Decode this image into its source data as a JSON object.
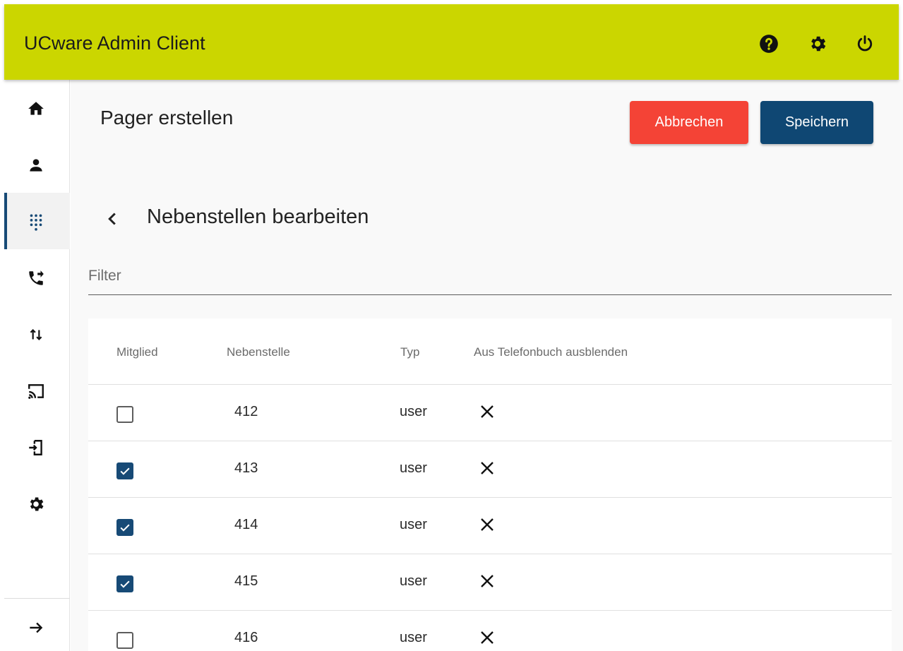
{
  "app": {
    "title": "UCware Admin Client"
  },
  "header_icons": [
    "help-icon",
    "settings-icon",
    "power-icon"
  ],
  "sidebar": {
    "items": [
      {
        "icon": "home-icon",
        "active": false
      },
      {
        "icon": "person-icon",
        "active": false
      },
      {
        "icon": "dialpad-icon",
        "active": true
      },
      {
        "icon": "phone-forward-icon",
        "active": false
      },
      {
        "icon": "swap-vert-icon",
        "active": false
      },
      {
        "icon": "cast-icon",
        "active": false
      },
      {
        "icon": "phone-login-icon",
        "active": false
      },
      {
        "icon": "settings-icon",
        "active": false
      }
    ],
    "footer_icon": "arrow-right-icon"
  },
  "page": {
    "title": "Pager erstellen",
    "cancel_label": "Abbrechen",
    "save_label": "Speichern",
    "section_title": "Nebenstellen bearbeiten"
  },
  "filter": {
    "placeholder": "Filter",
    "value": ""
  },
  "table": {
    "columns": [
      "Mitglied",
      "Nebenstelle",
      "Typ",
      "Aus Telefonbuch ausblenden"
    ],
    "rows": [
      {
        "member": false,
        "extension": "412",
        "type": "user",
        "hidden_icon": "close-icon"
      },
      {
        "member": true,
        "extension": "413",
        "type": "user",
        "hidden_icon": "close-icon"
      },
      {
        "member": true,
        "extension": "414",
        "type": "user",
        "hidden_icon": "close-icon"
      },
      {
        "member": true,
        "extension": "415",
        "type": "user",
        "hidden_icon": "close-icon"
      },
      {
        "member": false,
        "extension": "416",
        "type": "user",
        "hidden_icon": "close-icon"
      }
    ]
  },
  "colors": {
    "header": "#cbd600",
    "primary": "#0f4773",
    "danger": "#f44336"
  }
}
